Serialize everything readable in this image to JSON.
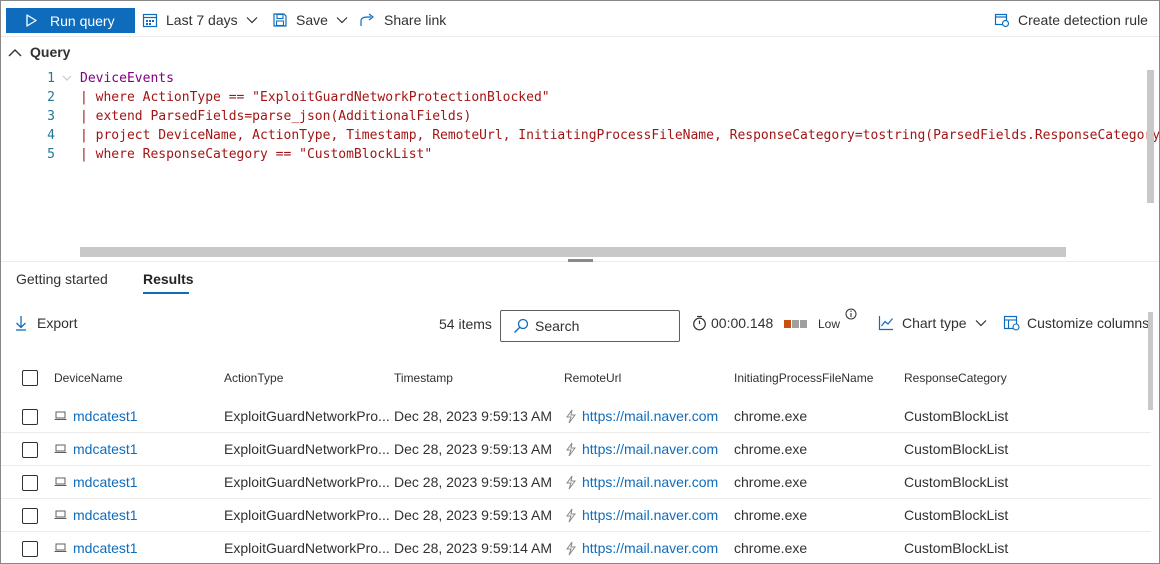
{
  "toolbar": {
    "run_query": "Run query",
    "time_range": "Last 7 days",
    "save": "Save",
    "share": "Share link",
    "create_rule": "Create detection rule"
  },
  "query": {
    "title": "Query",
    "line_numbers": [
      "1",
      "2",
      "3",
      "4",
      "5"
    ],
    "lines": [
      "DeviceEvents",
      "| where ActionType == \"ExploitGuardNetworkProtectionBlocked\"",
      "| extend ParsedFields=parse_json(AdditionalFields)",
      "| project DeviceName, ActionType, Timestamp, RemoteUrl, InitiatingProcessFileName, ResponseCategory=tostring(ParsedFields.ResponseCategory)",
      "| where ResponseCategory == \"CustomBlockList\""
    ]
  },
  "tabs": {
    "getting_started": "Getting started",
    "results": "Results"
  },
  "results_toolbar": {
    "export": "Export",
    "items_count": "54 items",
    "search_placeholder": "Search",
    "elapsed": "00:00.148",
    "cost_label": "Low",
    "chart_type": "Chart type",
    "customize_columns": "Customize columns"
  },
  "table": {
    "columns": [
      "DeviceName",
      "ActionType",
      "Timestamp",
      "RemoteUrl",
      "InitiatingProcessFileName",
      "ResponseCategory"
    ],
    "rows": [
      {
        "device": "mdcatest1",
        "action": "ExploitGuardNetworkPro...",
        "timestamp": "Dec 28, 2023 9:59:13 AM",
        "url": "https://mail.naver.com",
        "process": "chrome.exe",
        "category": "CustomBlockList"
      },
      {
        "device": "mdcatest1",
        "action": "ExploitGuardNetworkPro...",
        "timestamp": "Dec 28, 2023 9:59:13 AM",
        "url": "https://mail.naver.com",
        "process": "chrome.exe",
        "category": "CustomBlockList"
      },
      {
        "device": "mdcatest1",
        "action": "ExploitGuardNetworkPro...",
        "timestamp": "Dec 28, 2023 9:59:13 AM",
        "url": "https://mail.naver.com",
        "process": "chrome.exe",
        "category": "CustomBlockList"
      },
      {
        "device": "mdcatest1",
        "action": "ExploitGuardNetworkPro...",
        "timestamp": "Dec 28, 2023 9:59:13 AM",
        "url": "https://mail.naver.com",
        "process": "chrome.exe",
        "category": "CustomBlockList"
      },
      {
        "device": "mdcatest1",
        "action": "ExploitGuardNetworkPro...",
        "timestamp": "Dec 28, 2023 9:59:14 AM",
        "url": "https://mail.naver.com",
        "process": "chrome.exe",
        "category": "CustomBlockList"
      }
    ]
  },
  "colors": {
    "accent": "#0f6cbd",
    "cost_high": "#ca5010",
    "cost_low": "#a19f9d"
  }
}
